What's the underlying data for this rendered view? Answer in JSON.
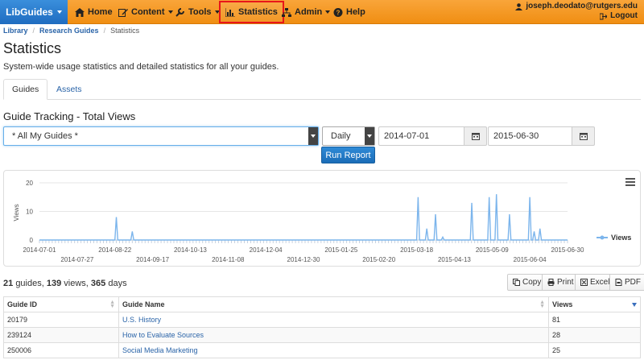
{
  "navbar": {
    "brand": "LibGuides",
    "items": [
      {
        "label": "Home",
        "icon": "home-icon"
      },
      {
        "label": "Content",
        "icon": "edit-icon"
      },
      {
        "label": "Tools",
        "icon": "wrench-icon"
      },
      {
        "label": "Statistics",
        "icon": "bar-chart-icon"
      },
      {
        "label": "Admin",
        "icon": "sitemap-icon"
      },
      {
        "label": "Help",
        "icon": "question-icon"
      }
    ],
    "user_email": "joseph.deodato@rutgers.edu",
    "logout": "Logout",
    "highlight_color": "#e8161a"
  },
  "breadcrumb": [
    "Library",
    "Research Guides",
    "Statistics"
  ],
  "page": {
    "title": "Statistics",
    "description": "System-wide usage statistics and detailed statistics for all your guides."
  },
  "tabs": [
    "Guides",
    "Assets"
  ],
  "tracking": {
    "title": "Guide Tracking - Total Views",
    "guide_select": "* All My Guides *",
    "period_select": "Daily",
    "start_date": "2014-07-01",
    "end_date": "2015-06-30",
    "run_button": "Run Report"
  },
  "chart_data": {
    "type": "line",
    "ylabel": "Views",
    "yticks": [
      0,
      10,
      20
    ],
    "ylim": [
      0,
      20
    ],
    "legend": "Views",
    "legend_position": "right",
    "x_tick_labels_upper": [
      "2014-07-01",
      "2014-08-22",
      "2014-10-13",
      "2014-12-04",
      "2015-01-25",
      "2015-03-18",
      "2015-05-09",
      "2015-06-30"
    ],
    "x_tick_labels_lower": [
      "2014-07-27",
      "2014-09-17",
      "2014-11-08",
      "2014-12-30",
      "2015-02-20",
      "2015-04-13",
      "2015-06-04"
    ],
    "series": [
      {
        "name": "Views",
        "peaks": [
          {
            "date": "2014-08-23",
            "value": 8
          },
          {
            "date": "2014-09-03",
            "value": 3
          },
          {
            "date": "2015-03-19",
            "value": 15
          },
          {
            "date": "2015-03-25",
            "value": 4
          },
          {
            "date": "2015-03-31",
            "value": 9
          },
          {
            "date": "2015-04-05",
            "value": 1
          },
          {
            "date": "2015-04-25",
            "value": 13
          },
          {
            "date": "2015-05-07",
            "value": 15
          },
          {
            "date": "2015-05-12",
            "value": 16
          },
          {
            "date": "2015-05-21",
            "value": 9
          },
          {
            "date": "2015-06-04",
            "value": 15
          },
          {
            "date": "2015-06-07",
            "value": 3
          },
          {
            "date": "2015-06-11",
            "value": 4
          }
        ]
      }
    ],
    "line_color": "#7cb5ec"
  },
  "summary": {
    "guides": "21",
    "guides_label": "guides,",
    "views": "139",
    "views_label": "views,",
    "days": "365",
    "days_label": "days"
  },
  "export_buttons": [
    {
      "label": "Copy",
      "icon": "copy-icon"
    },
    {
      "label": "Print",
      "icon": "print-icon"
    },
    {
      "label": "Excel",
      "icon": "excel-icon"
    },
    {
      "label": "PDF",
      "icon": "pdf-icon"
    }
  ],
  "table": {
    "headers": [
      "Guide ID",
      "Guide Name",
      "Views"
    ],
    "rows": [
      {
        "id": "20179",
        "name": "U.S. History",
        "views": "81"
      },
      {
        "id": "239124",
        "name": "How to Evaluate Sources",
        "views": "28"
      },
      {
        "id": "250006",
        "name": "Social Media Marketing",
        "views": "25"
      }
    ]
  }
}
